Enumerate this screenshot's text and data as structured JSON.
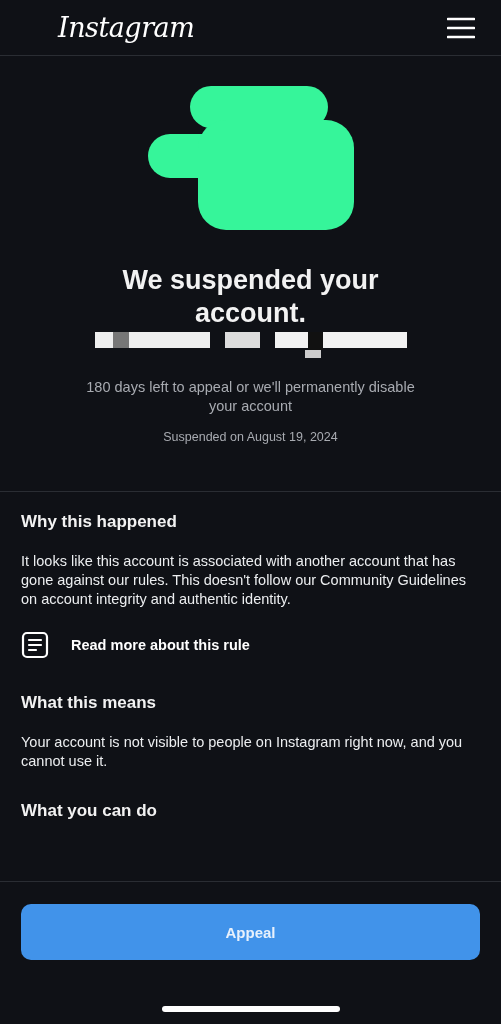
{
  "header": {
    "logo": "Instagram"
  },
  "notice": {
    "title": "We suspended your account.",
    "appeal_window": "180 days left to appeal or we'll permanently disable your account",
    "date": "Suspended on August 19, 2024"
  },
  "sections": [
    {
      "kind": "text",
      "heading": "Why this happened",
      "body": "It looks like this account is associated with another account that has gone against our rules. This doesn't follow our Community Guidelines on account integrity and authentic identity.",
      "link": "Read more about this rule"
    },
    {
      "kind": "text",
      "heading": "What this means",
      "body": "Your account is not visible to people on Instagram right now, and you cannot use it."
    },
    {
      "kind": "heading",
      "heading": "What you can do"
    }
  ],
  "footer": {
    "button": "Appeal"
  }
}
